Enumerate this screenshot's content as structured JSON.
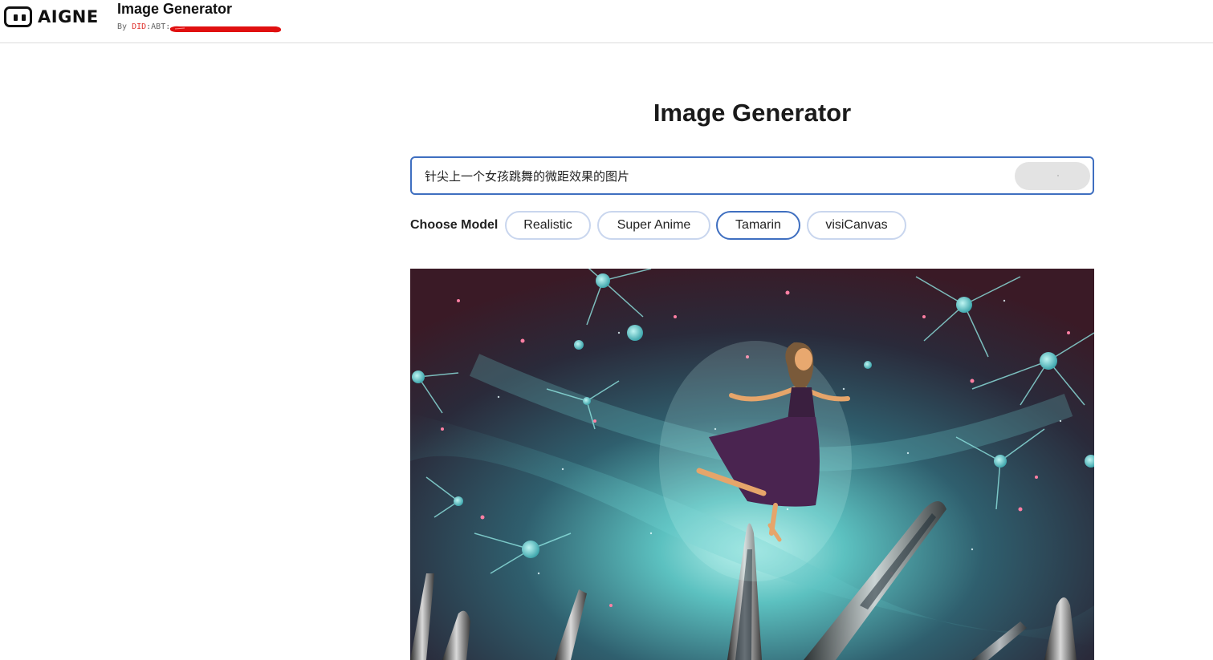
{
  "header": {
    "logo_text": "AIGNE",
    "app_title": "Image Generator",
    "by_label": "By",
    "did_prefix": "DID",
    "did_suffix": ":ABT:"
  },
  "main": {
    "page_title": "Image Generator",
    "prompt": {
      "value": "针尖上一个女孩跳舞的微距效果的图片"
    },
    "model_label": "Choose Model",
    "models": [
      {
        "label": "Realistic",
        "selected": false
      },
      {
        "label": "Super Anime",
        "selected": false
      },
      {
        "label": "Tamarin",
        "selected": true
      },
      {
        "label": "visiCanvas",
        "selected": false
      }
    ]
  },
  "colors": {
    "accent": "#3f6fc0",
    "chip_border": "#c9d6ee",
    "did_red": "#e0322e",
    "redaction": "#e01010"
  }
}
